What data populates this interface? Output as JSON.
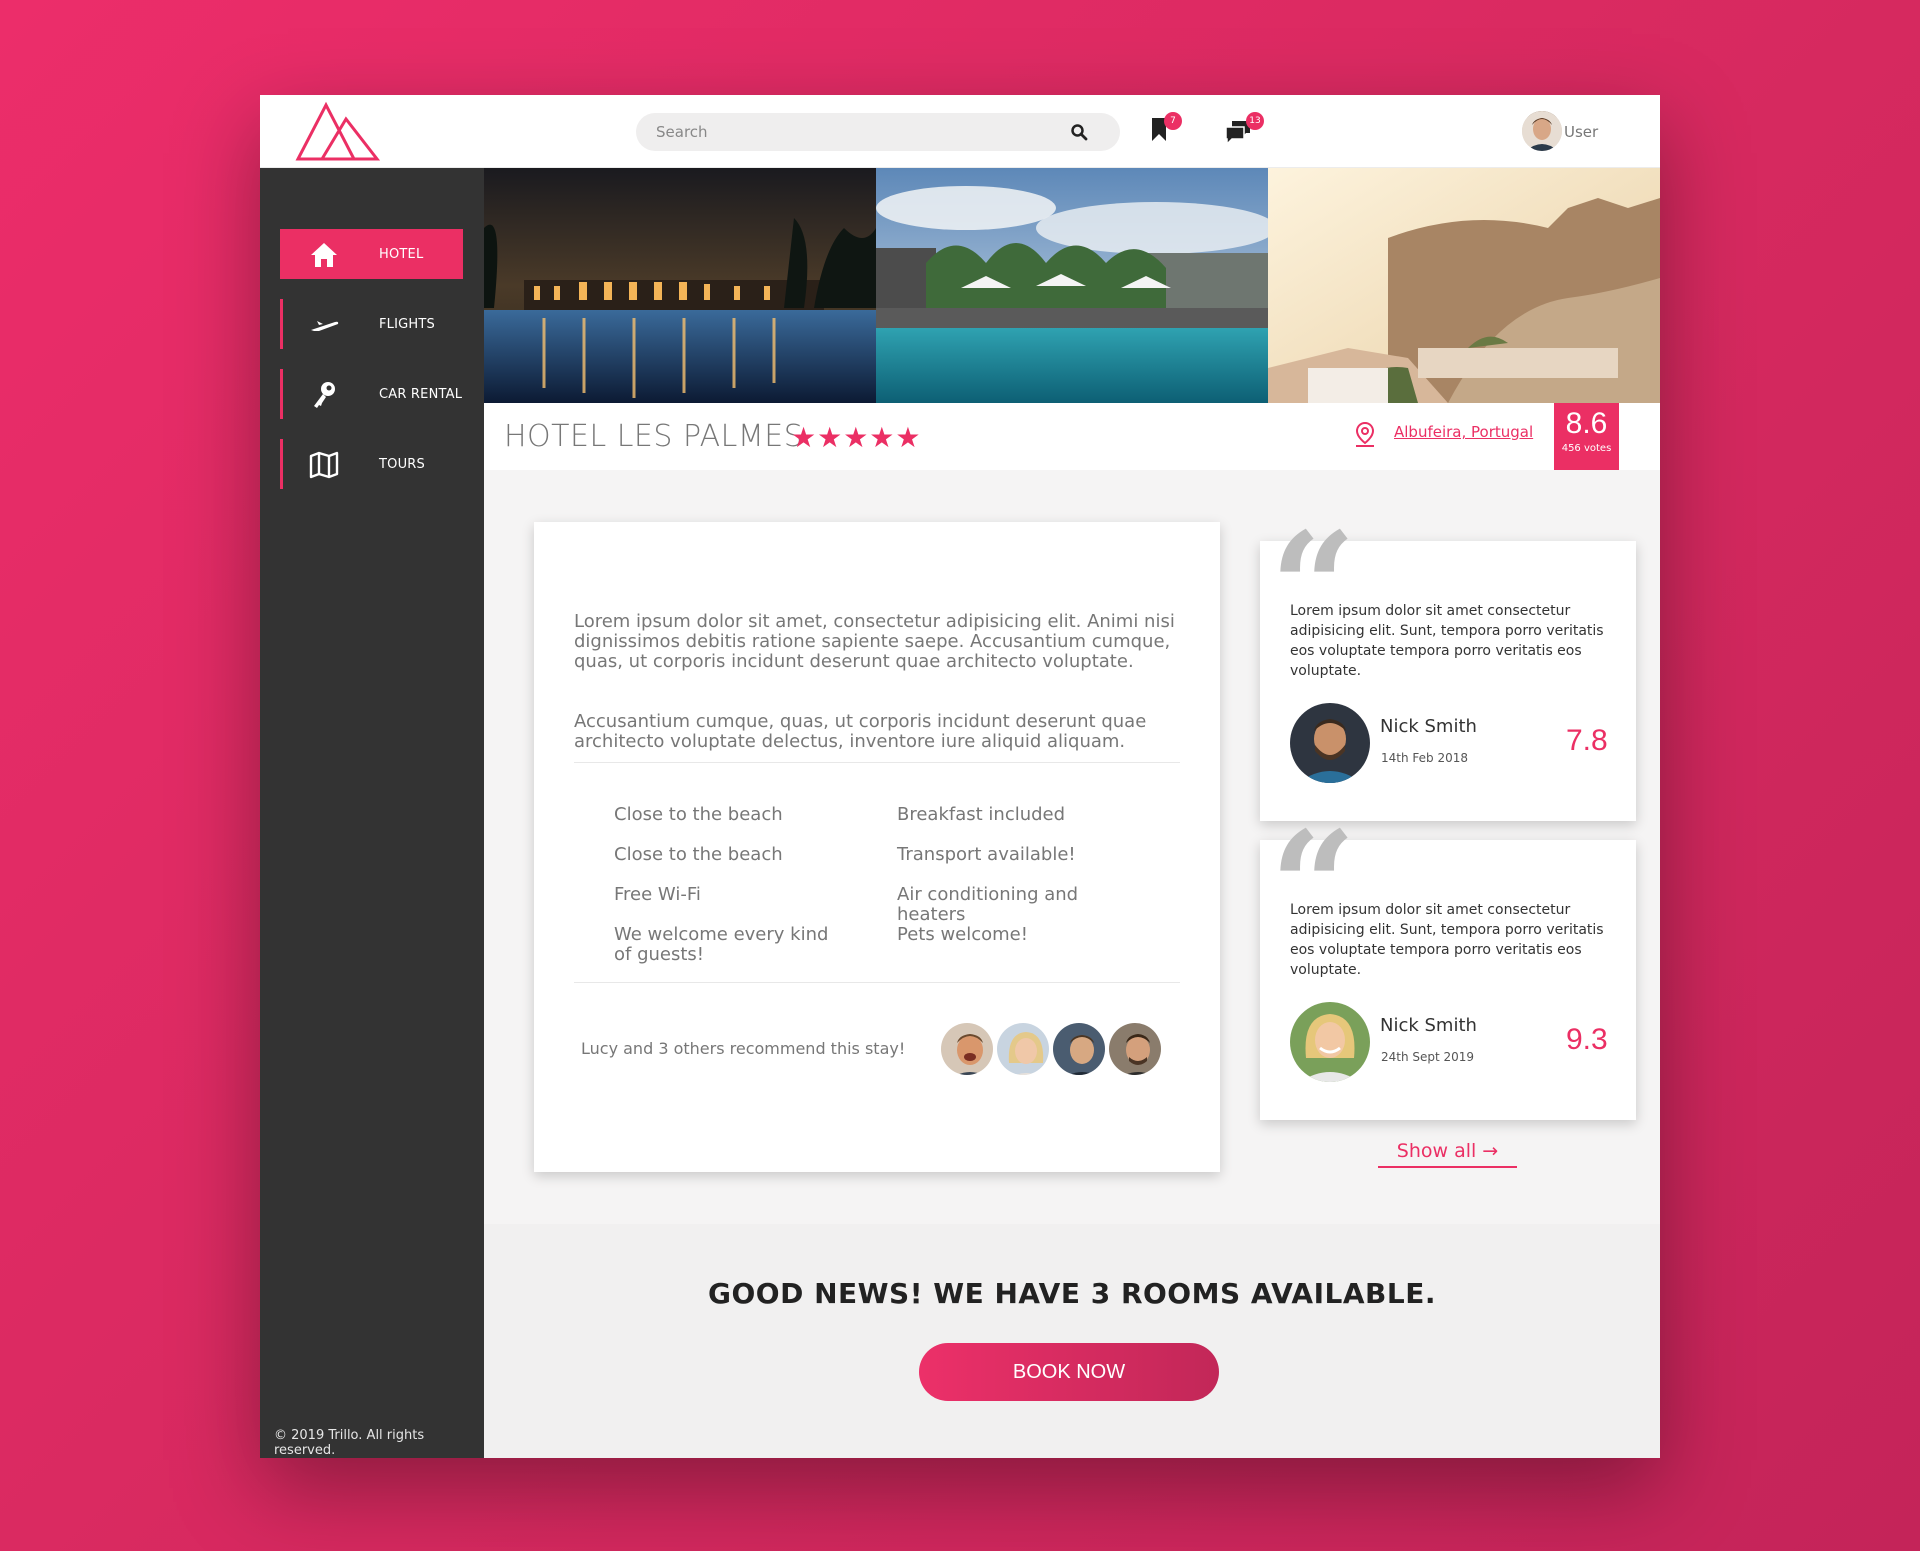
{
  "header": {
    "search_placeholder": "Search",
    "bookmarks_count": "7",
    "messages_count": "13",
    "user_name": "User"
  },
  "sidebar": {
    "items": [
      {
        "label": "HOTEL",
        "icon": "home-icon",
        "active": true
      },
      {
        "label": "FLIGHTS",
        "icon": "plane-icon",
        "active": false
      },
      {
        "label": "CAR RENTAL",
        "icon": "key-icon",
        "active": false
      },
      {
        "label": "TOURS",
        "icon": "map-icon",
        "active": false
      }
    ],
    "copyright": "© 2019 Trillo. All rights reserved."
  },
  "hotel": {
    "name": "HOTEL LES PALMES",
    "stars": "★★★★★",
    "location": "Albufeira, Portugal",
    "rating": "8.6",
    "votes": "456 votes"
  },
  "description": {
    "paragraph1": "Lorem ipsum dolor sit amet, consectetur adipisicing elit. Animi nisi dignissimos debitis ratione sapiente saepe. Accusantium cumque, quas, ut corporis incidunt deserunt quae architecto voluptate.",
    "paragraph2": "Accusantium cumque, quas, ut corporis incidunt deserunt quae architecto voluptate delectus, inventore iure aliquid aliquam.",
    "features": [
      "Close to the beach",
      "Breakfast included",
      "Close to the beach",
      "Transport available!",
      "Free Wi-Fi",
      "Air conditioning and heaters",
      "We welcome every kind of guests!",
      "Pets welcome!"
    ],
    "recommend_text": "Lucy and 3 others recommend this stay!"
  },
  "reviews": [
    {
      "text": "Lorem ipsum dolor sit amet consectetur adipisicing elit. Sunt, tempora porro veritatis eos voluptate tempora porro veritatis eos voluptate.",
      "name": "Nick Smith",
      "date": "14th Feb 2018",
      "score": "7.8"
    },
    {
      "text": "Lorem ipsum dolor sit amet consectetur adipisicing elit. Sunt, tempora porro veritatis eos voluptate tempora porro veritatis eos voluptate.",
      "name": "Nick Smith",
      "date": "24th Sept 2019",
      "score": "9.3"
    }
  ],
  "show_all": "Show all →",
  "cta": {
    "heading": "GOOD NEWS! WE HAVE 3 ROOMS AVAILABLE.",
    "button": "BOOK NOW"
  },
  "colors": {
    "primary": "#eb2f64",
    "sidebar": "#333333",
    "background": "#f5f4f4"
  }
}
